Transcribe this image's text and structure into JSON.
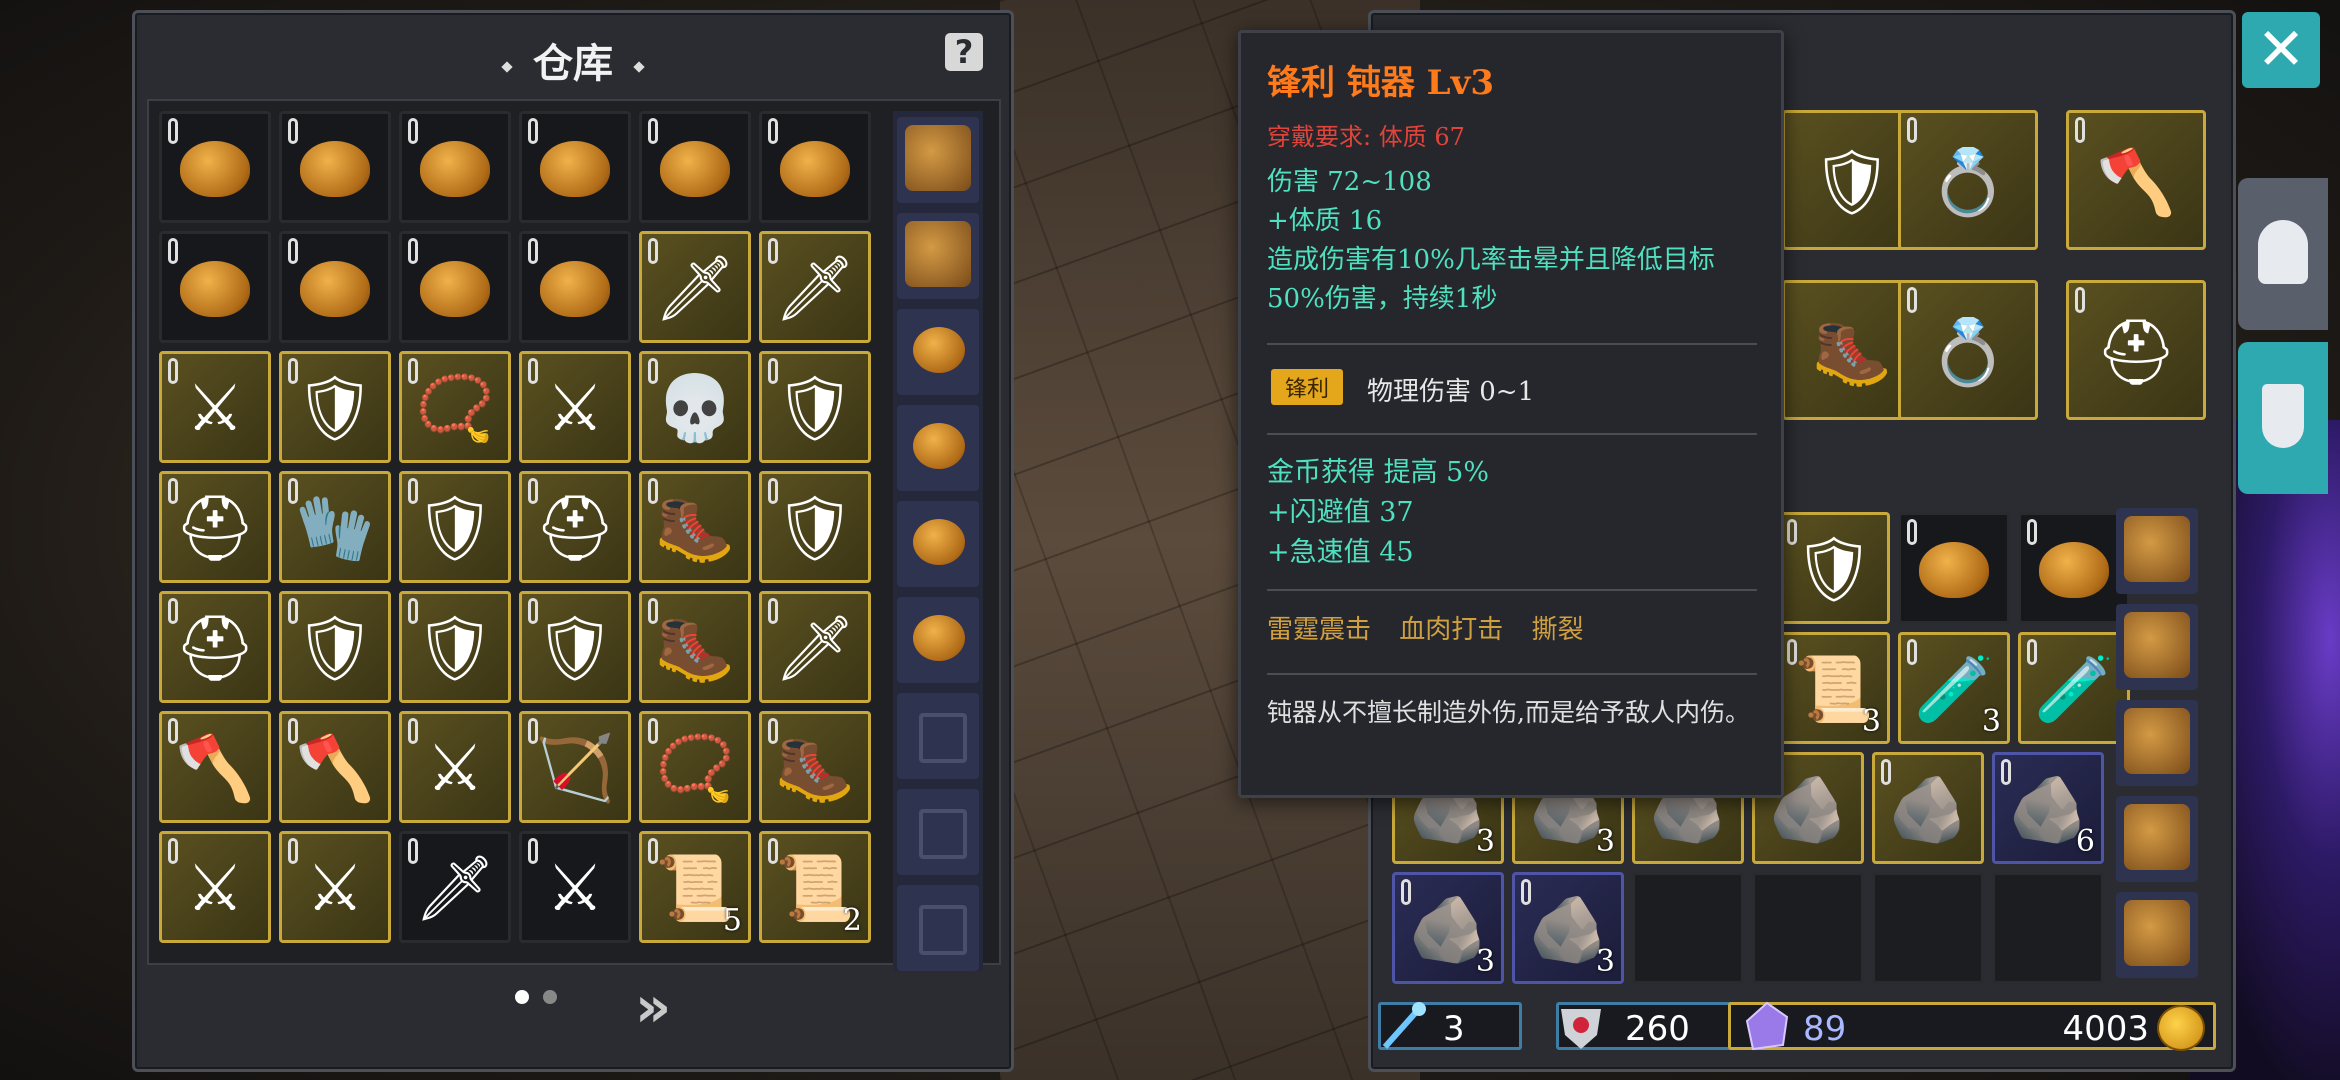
{
  "warehouse": {
    "title": "仓库",
    "help_label": "?",
    "grid": [
      [
        {
          "t": "pouch"
        },
        {
          "t": "pouch"
        },
        {
          "t": "pouch"
        },
        {
          "t": "pouch"
        },
        {
          "t": "pouch"
        },
        {
          "t": "pouch"
        }
      ],
      [
        {
          "t": "pouch"
        },
        {
          "t": "pouch"
        },
        {
          "t": "pouch"
        },
        {
          "t": "pouch"
        },
        {
          "t": "sword",
          "q": "gold"
        },
        {
          "t": "sword",
          "q": "gold"
        }
      ],
      [
        {
          "t": "spear",
          "q": "gold"
        },
        {
          "t": "armor",
          "q": "gold"
        },
        {
          "t": "amulet",
          "q": "gold"
        },
        {
          "t": "spear",
          "q": "gold"
        },
        {
          "t": "mask",
          "q": "gold"
        },
        {
          "t": "armor",
          "q": "gold"
        }
      ],
      [
        {
          "t": "helm",
          "q": "gold"
        },
        {
          "t": "glove",
          "q": "gold"
        },
        {
          "t": "armor",
          "q": "gold"
        },
        {
          "t": "helm",
          "q": "gold"
        },
        {
          "t": "boot",
          "q": "gold"
        },
        {
          "t": "armor",
          "q": "gold"
        }
      ],
      [
        {
          "t": "helm",
          "q": "gold"
        },
        {
          "t": "armor",
          "q": "gold"
        },
        {
          "t": "armor",
          "q": "gold"
        },
        {
          "t": "armor",
          "q": "gold"
        },
        {
          "t": "boot",
          "q": "gold"
        },
        {
          "t": "sword",
          "q": "gold"
        }
      ],
      [
        {
          "t": "axe",
          "q": "gold"
        },
        {
          "t": "axe",
          "q": "gold"
        },
        {
          "t": "spear",
          "q": "gold"
        },
        {
          "t": "bow",
          "q": "gold"
        },
        {
          "t": "amulet",
          "q": "gold"
        },
        {
          "t": "boot",
          "q": "gold"
        }
      ],
      [
        {
          "t": "spear",
          "q": "gold"
        },
        {
          "t": "spear",
          "q": "gold"
        },
        {
          "t": "sword"
        },
        {
          "t": "spear"
        },
        {
          "t": "scroll",
          "q": "gold",
          "count": "5"
        },
        {
          "t": "scroll",
          "q": "gold",
          "count": "2"
        }
      ]
    ],
    "side_bags": [
      "bag",
      "bag",
      "pouch",
      "pouch",
      "pouch",
      "pouch",
      "locked",
      "locked",
      "locked"
    ],
    "page_dots": 2,
    "next_label": "»"
  },
  "tooltip": {
    "title": "锋利 钝器 Lv3",
    "requirement": "穿戴要求:  体质 67",
    "stats": [
      "伤害  72~108",
      "+体质  16",
      "造成伤害有10%几率击晕并且降低目标50%伤害，持续1秒"
    ],
    "affix_tag": "锋利",
    "affix_text": "物理伤害  0~1",
    "bonus": [
      "金币获得  提高  5%",
      "+闪避值  37",
      "+急速值  45"
    ],
    "skills": "雷霆震击  血肉打击  撕裂",
    "description": "钝器从不擅长制造外伤,而是给予敌人内伤。"
  },
  "inventory": {
    "equip": [
      {
        "t": "armor",
        "q": "gold"
      },
      {
        "t": "ring",
        "q": "gold"
      },
      {
        "t": "axe",
        "q": "gold"
      },
      {
        "t": "boot",
        "q": "gold"
      },
      {
        "t": "ring",
        "q": "gold"
      },
      {
        "t": "helm",
        "q": "gold"
      }
    ],
    "rows": [
      [
        {
          "t": "armor",
          "q": "gold"
        },
        {
          "t": "pouch"
        },
        {
          "t": "pouch"
        }
      ],
      [
        {
          "t": "scroll",
          "q": "gold",
          "count": "3"
        },
        {
          "t": "potion",
          "q": "gold",
          "count": "3"
        },
        {
          "t": "potion",
          "q": "gold"
        }
      ],
      [
        {
          "t": "shard",
          "q": "gold",
          "count": "3"
        },
        {
          "t": "shard",
          "q": "gold",
          "count": "3"
        },
        {
          "t": "shard",
          "q": "gold"
        },
        {
          "t": "shard",
          "q": "gold"
        },
        {
          "t": "shard",
          "q": "gold"
        },
        {
          "t": "shard",
          "q": "blue",
          "count": "6"
        }
      ],
      [
        {
          "t": "shard",
          "q": "blue",
          "count": "3"
        },
        {
          "t": "shard",
          "q": "blue",
          "count": "3"
        },
        {
          "t": "empty"
        },
        {
          "t": "empty"
        },
        {
          "t": "empty"
        },
        {
          "t": "empty"
        }
      ]
    ],
    "side_bags": [
      "bag",
      "bag",
      "pack",
      "pack",
      "bag"
    ]
  },
  "currency": {
    "dust": "3",
    "hearts": "260",
    "crystals": "89",
    "gold": "4003"
  },
  "colors": {
    "gold_border": "#c9a93a",
    "blue_border": "#4e55a8",
    "tooltip_title": "#ff7a1a",
    "tooltip_stat": "#4fe0c0",
    "accent_teal": "#2fa9b0"
  }
}
